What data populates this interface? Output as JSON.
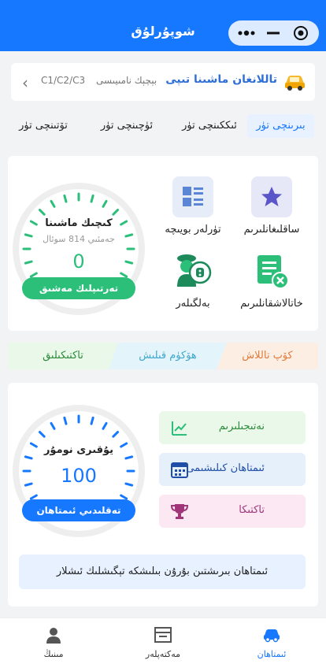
{
  "header": {
    "title": "شوپۇرلۇق"
  },
  "car_type": {
    "codes": "C1/C2/C3",
    "hint": "بېچېك نامىيىسى",
    "title": "تاللانغان ماشىنا تىپى"
  },
  "tabs": [
    {
      "label": "بىرىنچى تۈر",
      "active": true
    },
    {
      "label": "ئىككىنچى تۈر",
      "active": false
    },
    {
      "label": "ئۈچىنچى تۈر",
      "active": false
    },
    {
      "label": "تۆتىنچى تۈر",
      "active": false
    }
  ],
  "practice_gauge": {
    "title": "كىچىك ماشىنا",
    "subtitle": "جەمئىي 814 سوئال",
    "value": "0",
    "button": "تەرتىپلىك مەشىق",
    "color": "#2bbf7a"
  },
  "tools": {
    "favorites": "ساقلىغانلىرىم",
    "chapters": "تۈرلەر بويىچە",
    "mistakes": "خاتالاشقانلىرىم",
    "signs": "بەلگىلەر"
  },
  "ribbon": {
    "all": "كۆپ تاللاش",
    "judge": "ھۆكۈم قىلىش",
    "stats": "تاكتىكىلىق"
  },
  "exam_gauge": {
    "title": "يۇقىرى نومۇر",
    "value": "100",
    "button": "تەقلىدىي ئىمتاھان",
    "color": "#1677ff"
  },
  "mini_cards": {
    "results": "نەتىجىلىرىم",
    "schedule": "ئىمتاھان كىلىشىمى",
    "tips": "تاكتىكا"
  },
  "notice": "ئىمتاھان بىرىشتىن بۇرۇن بىلىشكە تېگىشلىك ئىشلار",
  "nav": {
    "exam": "ئىمتاھان",
    "school": "مەكتەپلەر",
    "mine": "مىنىڭ"
  }
}
